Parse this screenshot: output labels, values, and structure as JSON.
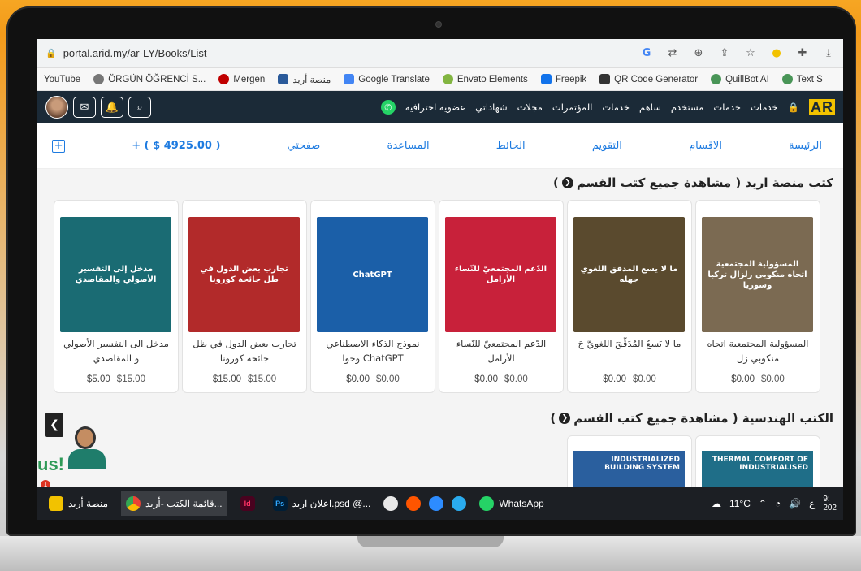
{
  "browser": {
    "url": "portal.arid.my/ar-LY/Books/List",
    "bookmarks": [
      {
        "label": "YouTube",
        "color": "#ff0000"
      },
      {
        "label": "ÖRGÜN ÖĞRENCİ S...",
        "color": "#666666"
      },
      {
        "label": "Mergen",
        "color": "#c00000"
      },
      {
        "label": "منصة أريد",
        "color": "#2a5a9a"
      },
      {
        "label": "Google Translate",
        "color": "#4285f4"
      },
      {
        "label": "Envato Elements",
        "color": "#82b541"
      },
      {
        "label": "Freepik",
        "color": "#1273eb"
      },
      {
        "label": "QR Code Generator",
        "color": "#333333"
      },
      {
        "label": "QuillBot AI",
        "color": "#499557"
      },
      {
        "label": "Text S",
        "color": "#499557"
      }
    ]
  },
  "site": {
    "logo": "AR",
    "top_nav": [
      "خدمات",
      "خدمات",
      "مستخدم",
      "ساهم",
      "خدمات",
      "المؤتمرات",
      "مجلات",
      "شهاداتي",
      "عضوية احترافية"
    ],
    "nav": {
      "home": "الرئيسة",
      "sections": "الاقسام",
      "calendar": "التقويم",
      "wall": "الحائط",
      "help": "المساعدة",
      "my_page": "صفحتي",
      "balance": "+ ( $ 4925.00 )"
    }
  },
  "section1": {
    "title": "كتب منصة اريد ( مشاهدة جميع كتب القسم",
    "close_paren": ")",
    "books": [
      {
        "title": "المسؤولية المجتمعية اتجاه منكوبي زل",
        "price": "$0.00",
        "old_price": "$0.00",
        "cover_text": "المسؤولية المجتمعية اتجاه منكوبي زلزال تركيا وسوريا",
        "color": "#7b6a52"
      },
      {
        "title": "ما لا يَسعُ المُدَقِّقَ اللغويَّ جَ",
        "price": "$0.00",
        "old_price": "$0.00",
        "cover_text": "ما لا يسع المدقق اللغوي جهله",
        "color": "#5a4a2e"
      },
      {
        "title": "الدّعم المجتمعيّ للنّساء الأرامل",
        "price": "$0.00",
        "old_price": "$0.00",
        "cover_text": "الدّعم المجتمعيّ للنّساء الأرامل",
        "color": "#c8213a"
      },
      {
        "title": "نموذج الذكاء الاصطناعي ChatGPT وحوا",
        "price": "$0.00",
        "old_price": "$0.00",
        "cover_text": "ChatGPT",
        "color": "#1b5fa8"
      },
      {
        "title": "تجارب بعض الدول في ظل جائحة كورونا",
        "price": "$15.00",
        "old_price": "$15.00",
        "cover_text": "تجارب بعض الدول في ظل جائحة كورونا",
        "color": "#b22a2a"
      },
      {
        "title": "مدخل الى التفسير الأصولي و المقاصدي",
        "price": "$5.00",
        "old_price": "$15.00",
        "cover_text": "مدخل إلى التفسير الأصولي والمقاصدي",
        "color": "#1a6b73"
      }
    ]
  },
  "section2": {
    "title": "الكتب الهندسية ( مشاهدة جميع كتب القسم",
    "close_paren": ")",
    "books": [
      {
        "cover_text": "THERMAL COMFORT OF INDUSTRIALISED",
        "color": "#1f6e88"
      },
      {
        "cover_text": "INDUSTRIALIZED BUILDING SYSTEM",
        "color": "#2a5f9e"
      }
    ]
  },
  "support": {
    "text": "us!",
    "badge": "1"
  },
  "taskbar": {
    "items": [
      {
        "label": "منصة أريد",
        "icon": "folder-icon",
        "color": "#f2c200"
      },
      {
        "label": "قائمة الكتب -أريد...",
        "icon": "chrome-icon",
        "color": "#4285f4"
      },
      {
        "label": "Id",
        "icon": "indesign-icon",
        "color": "#49021f"
      },
      {
        "label": "اعلان اريد.psd @...",
        "icon": "photoshop-icon",
        "color": "#001e36"
      },
      {
        "label": "WhatsApp",
        "icon": "whatsapp-icon",
        "color": "#25d366"
      }
    ],
    "temp": "11°C",
    "lang": "ع",
    "time": "9:",
    "date": "202"
  }
}
